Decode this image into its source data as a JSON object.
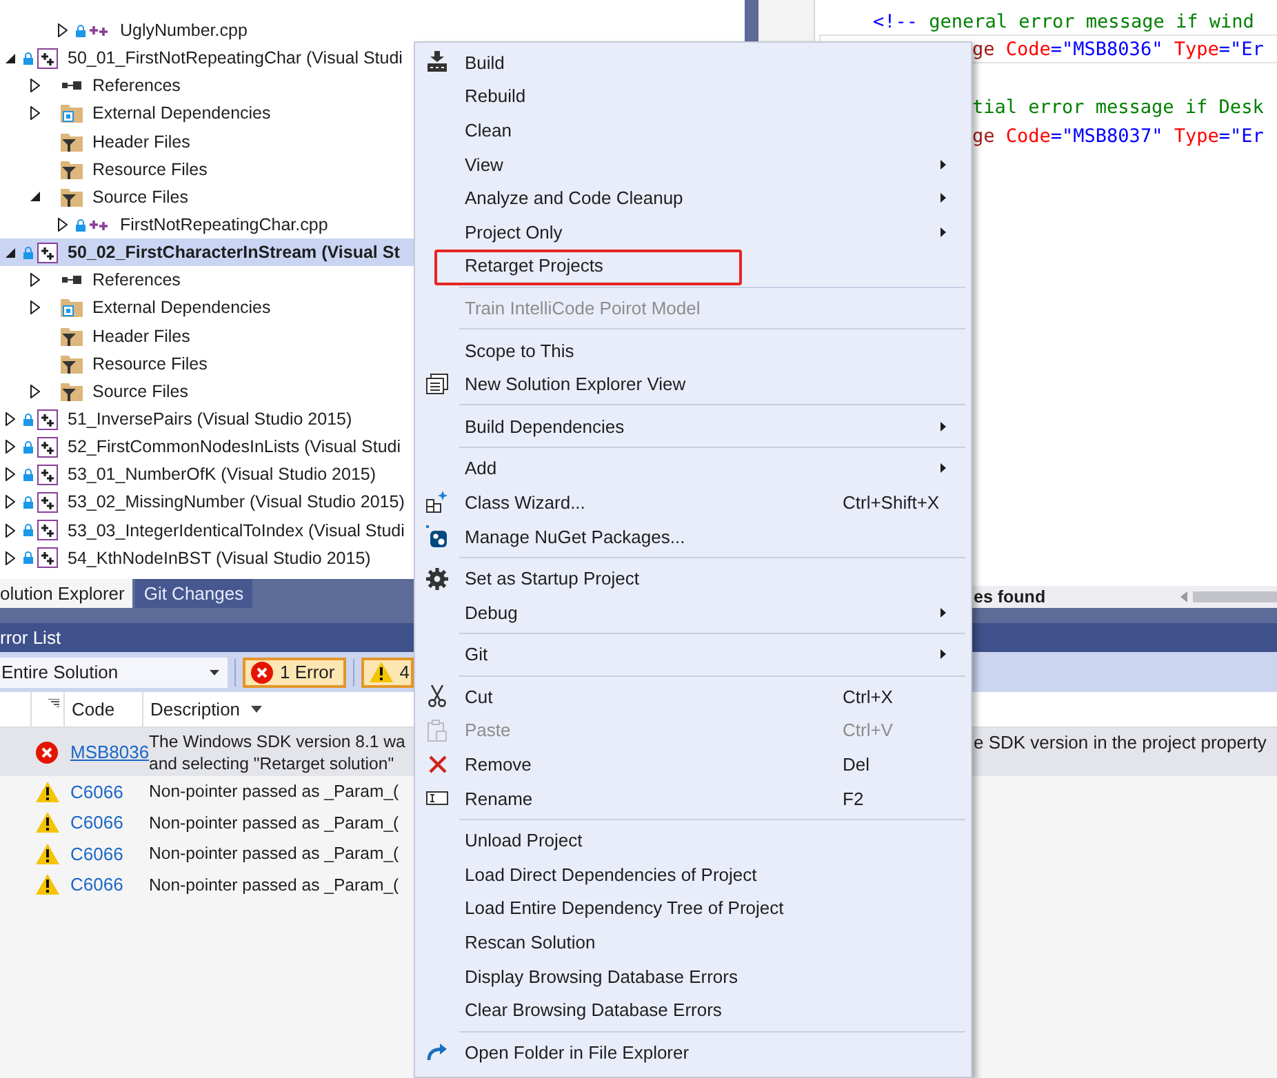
{
  "solution_explorer": {
    "tree": [
      {
        "children": [
          {
            "children": [
              {
                "label": "UglyNumber.cpp",
                "kind": "file",
                "expanded": false,
                "selected": false
              }
            ]
          }
        ]
      },
      {
        "label": "50_01_FirstNotRepeatingChar (Visual Studi",
        "kind": "project",
        "expanded": true,
        "selected": false,
        "children": [
          {
            "label": "References",
            "kind": "references",
            "expanded": false,
            "selected": false
          },
          {
            "label": "External Dependencies",
            "kind": "external",
            "expanded": false,
            "selected": false
          },
          {
            "label": "Header Files",
            "kind": "filter",
            "selected": false
          },
          {
            "label": "Resource Files",
            "kind": "filter",
            "selected": false
          },
          {
            "label": "Source Files",
            "kind": "filter",
            "expanded": true,
            "selected": false,
            "children": [
              {
                "label": "FirstNotRepeatingChar.cpp",
                "kind": "file",
                "expanded": false,
                "selected": false
              }
            ]
          }
        ]
      },
      {
        "label": "50_02_FirstCharacterInStream (Visual St",
        "kind": "project",
        "expanded": true,
        "selected": true,
        "children": [
          {
            "label": "References",
            "kind": "references",
            "expanded": false,
            "selected": false
          },
          {
            "label": "External Dependencies",
            "kind": "external",
            "expanded": false,
            "selected": false
          },
          {
            "label": "Header Files",
            "kind": "filter",
            "selected": false
          },
          {
            "label": "Resource Files",
            "kind": "filter",
            "selected": false
          },
          {
            "label": "Source Files",
            "kind": "filter",
            "expanded": false,
            "selected": false
          }
        ]
      },
      {
        "label": "51_InversePairs (Visual Studio 2015)",
        "kind": "project",
        "expanded": false,
        "selected": false
      },
      {
        "label": "52_FirstCommonNodesInLists (Visual Studi",
        "kind": "project",
        "expanded": false,
        "selected": false
      },
      {
        "label": "53_01_NumberOfK (Visual Studio 2015)",
        "kind": "project",
        "expanded": false,
        "selected": false
      },
      {
        "label": "53_02_MissingNumber (Visual Studio 2015)",
        "kind": "project",
        "expanded": false,
        "selected": false
      },
      {
        "label": "53_03_IntegerIdenticalToIndex (Visual Studi",
        "kind": "project",
        "expanded": false,
        "selected": false
      },
      {
        "label": "54_KthNodeInBST (Visual Studio 2015)",
        "kind": "project",
        "expanded": false,
        "selected": false
      }
    ]
  },
  "tabs": [
    {
      "label": "olution Explorer",
      "selected": true
    },
    {
      "label": "Git Changes",
      "selected": false
    }
  ],
  "editor": {
    "lines": [
      {
        "covered": false,
        "current": false,
        "tokens": [
          {
            "kind": "punct",
            "text": "<!--"
          },
          {
            "kind": "comment",
            "text": " general error message if wind"
          }
        ]
      },
      {
        "covered": true,
        "current": true,
        "tokens": [
          {
            "kind": "element",
            "text": "ge"
          },
          {
            "kind": "attr",
            "text": " Code"
          },
          {
            "kind": "punct",
            "text": "=\""
          },
          {
            "kind": "value",
            "text": "MSB8036"
          },
          {
            "kind": "punct",
            "text": "\""
          },
          {
            "kind": "attr",
            "text": " Type"
          },
          {
            "kind": "punct",
            "text": "=\""
          },
          {
            "kind": "value",
            "text": "Er"
          }
        ]
      },
      {
        "current": false
      },
      {
        "covered": true,
        "current": false,
        "tokens": [
          {
            "kind": "comment",
            "text": "tial error message if Desk"
          }
        ]
      },
      {
        "covered": true,
        "current": false,
        "tokens": [
          {
            "kind": "element",
            "text": "ge"
          },
          {
            "kind": "attr",
            "text": " Code"
          },
          {
            "kind": "punct",
            "text": "=\""
          },
          {
            "kind": "value",
            "text": "MSB8037"
          },
          {
            "kind": "punct",
            "text": "\""
          },
          {
            "kind": "attr",
            "text": " Type"
          },
          {
            "kind": "punct",
            "text": "=\""
          },
          {
            "kind": "value",
            "text": "Er"
          }
        ]
      }
    ],
    "status": "es found"
  },
  "error_list": {
    "title": "rror List",
    "scope": "Entire Solution",
    "filters": [
      {
        "kind": "error",
        "label": "1 Error",
        "selected": true
      },
      {
        "kind": "warning",
        "label": "4",
        "selected": true
      }
    ],
    "columns": [
      "Code",
      "Description"
    ],
    "rows": [
      {
        "kind": "error",
        "code": "MSB8036",
        "link": true,
        "description": [
          "The Windows SDK version 8.1 wa",
          "and selecting \"Retarget solution\""
        ],
        "tail": "e SDK version in the project property",
        "selected": true
      },
      {
        "kind": "warning",
        "code": "C6066",
        "link": false,
        "description": [
          "Non-pointer passed as _Param_("
        ],
        "selected": false
      },
      {
        "kind": "warning",
        "code": "C6066",
        "link": false,
        "description": [
          "Non-pointer passed as _Param_("
        ],
        "selected": false
      },
      {
        "kind": "warning",
        "code": "C6066",
        "link": false,
        "description": [
          "Non-pointer passed as _Param_("
        ],
        "selected": false
      },
      {
        "kind": "warning",
        "code": "C6066",
        "link": false,
        "description": [
          "Non-pointer passed as _Param_("
        ],
        "selected": false
      }
    ]
  },
  "context_menu": {
    "groups": [
      {
        "items": [
          {
            "label": "Build",
            "submenu": false,
            "disabled": false,
            "highlighted": false
          },
          {
            "label": "Rebuild",
            "submenu": false,
            "disabled": false,
            "highlighted": false
          },
          {
            "label": "Clean",
            "submenu": false,
            "disabled": false,
            "highlighted": false
          },
          {
            "label": "View",
            "submenu": true,
            "disabled": false,
            "highlighted": false
          },
          {
            "label": "Analyze and Code Cleanup",
            "submenu": true,
            "disabled": false,
            "highlighted": false
          },
          {
            "label": "Project Only",
            "submenu": true,
            "disabled": false,
            "highlighted": false
          },
          {
            "label": "Retarget Projects",
            "submenu": false,
            "disabled": false,
            "highlighted": true
          }
        ]
      },
      {
        "items": [
          {
            "label": "Train IntelliCode Poirot Model",
            "submenu": false,
            "disabled": true,
            "highlighted": false
          }
        ]
      },
      {
        "items": [
          {
            "label": "Scope to This",
            "submenu": false,
            "disabled": false,
            "highlighted": false
          },
          {
            "label": "New Solution Explorer View",
            "submenu": false,
            "disabled": false,
            "highlighted": false
          }
        ]
      },
      {
        "items": [
          {
            "label": "Build Dependencies",
            "submenu": true,
            "disabled": false,
            "highlighted": false
          }
        ]
      },
      {
        "items": [
          {
            "label": "Add",
            "submenu": true,
            "disabled": false,
            "highlighted": false
          },
          {
            "label": "Class Wizard...",
            "shortcut": "Ctrl+Shift+X",
            "submenu": false,
            "disabled": false,
            "highlighted": false
          },
          {
            "label": "Manage NuGet Packages...",
            "submenu": false,
            "disabled": false,
            "highlighted": false
          }
        ]
      },
      {
        "items": [
          {
            "label": "Set as Startup Project",
            "submenu": false,
            "disabled": false,
            "highlighted": false
          },
          {
            "label": "Debug",
            "submenu": true,
            "disabled": false,
            "highlighted": false
          }
        ]
      },
      {
        "items": [
          {
            "label": "Git",
            "submenu": true,
            "disabled": false,
            "highlighted": false
          }
        ]
      },
      {
        "items": [
          {
            "label": "Cut",
            "shortcut": "Ctrl+X",
            "submenu": false,
            "disabled": false,
            "highlighted": false
          },
          {
            "label": "Paste",
            "shortcut": "Ctrl+V",
            "submenu": false,
            "disabled": true,
            "highlighted": false
          },
          {
            "label": "Remove",
            "shortcut": "Del",
            "submenu": false,
            "disabled": false,
            "highlighted": false
          },
          {
            "label": "Rename",
            "shortcut": "F2",
            "submenu": false,
            "disabled": false,
            "highlighted": false
          }
        ]
      },
      {
        "items": [
          {
            "label": "Unload Project",
            "submenu": false,
            "disabled": false,
            "highlighted": false
          },
          {
            "label": "Load Direct Dependencies of Project",
            "submenu": false,
            "disabled": false,
            "highlighted": false
          },
          {
            "label": "Load Entire Dependency Tree of Project",
            "submenu": false,
            "disabled": false,
            "highlighted": false
          },
          {
            "label": "Rescan Solution",
            "submenu": false,
            "disabled": false,
            "highlighted": false
          },
          {
            "label": "Display Browsing Database Errors",
            "submenu": false,
            "disabled": false,
            "highlighted": false
          },
          {
            "label": "Clear Browsing Database Errors",
            "submenu": false,
            "disabled": false,
            "highlighted": false
          }
        ]
      },
      {
        "items": [
          {
            "label": "Open Folder in File Explorer",
            "submenu": false,
            "disabled": false,
            "highlighted": false
          }
        ]
      }
    ]
  }
}
